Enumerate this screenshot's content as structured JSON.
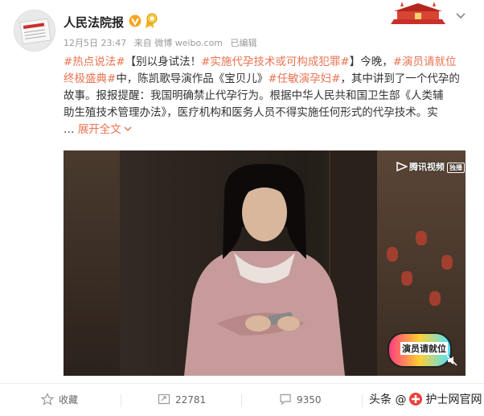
{
  "post": {
    "author_name": "人民法院报",
    "time": "12月5日 23:47",
    "source": "来自 微博 weibo.com",
    "edited": "已编辑",
    "content_lines": [
      [
        {
          "t": "#热点说法#",
          "tag": true
        },
        {
          "t": "【别以身试法！",
          "tag": false
        },
        {
          "t": "#实施代孕技术或可构成犯罪#",
          "tag": true
        },
        {
          "t": "】今晚，",
          "tag": false
        },
        {
          "t": "#演员请就位",
          "tag": true
        }
      ],
      [
        {
          "t": "终极盛典#",
          "tag": true
        },
        {
          "t": "中，陈凯歌导演作品《宝贝儿》",
          "tag": false
        },
        {
          "t": "#任敏演孕妇#",
          "tag": true
        },
        {
          "t": "，其中讲到了一个代孕的",
          "tag": false
        }
      ],
      [
        {
          "t": "故事。报报提醒：我国明确禁止代孕行为。根据中华人民共和国卫生部《人类辅",
          "tag": false
        }
      ],
      [
        {
          "t": "助生殖技术管理办法》，医疗机构和医务人员不得实施任何形式的代孕技术。实",
          "tag": false
        }
      ]
    ],
    "expand_prefix": "…",
    "expand_label": "展开全文",
    "expand_icon": "chevron-down-icon"
  },
  "video": {
    "watermark": "腾讯视频",
    "watermark_badge": "独播",
    "sticker_text": "演员请就位"
  },
  "actions": {
    "favorite_label": "收藏",
    "repost_count": "22781",
    "comment_count": "9350"
  },
  "source_watermark": {
    "prefix": "头条",
    "at": "@",
    "name": "护士网官网"
  },
  "colors": {
    "accent": "#eb7350",
    "verified": "#f5a623"
  }
}
